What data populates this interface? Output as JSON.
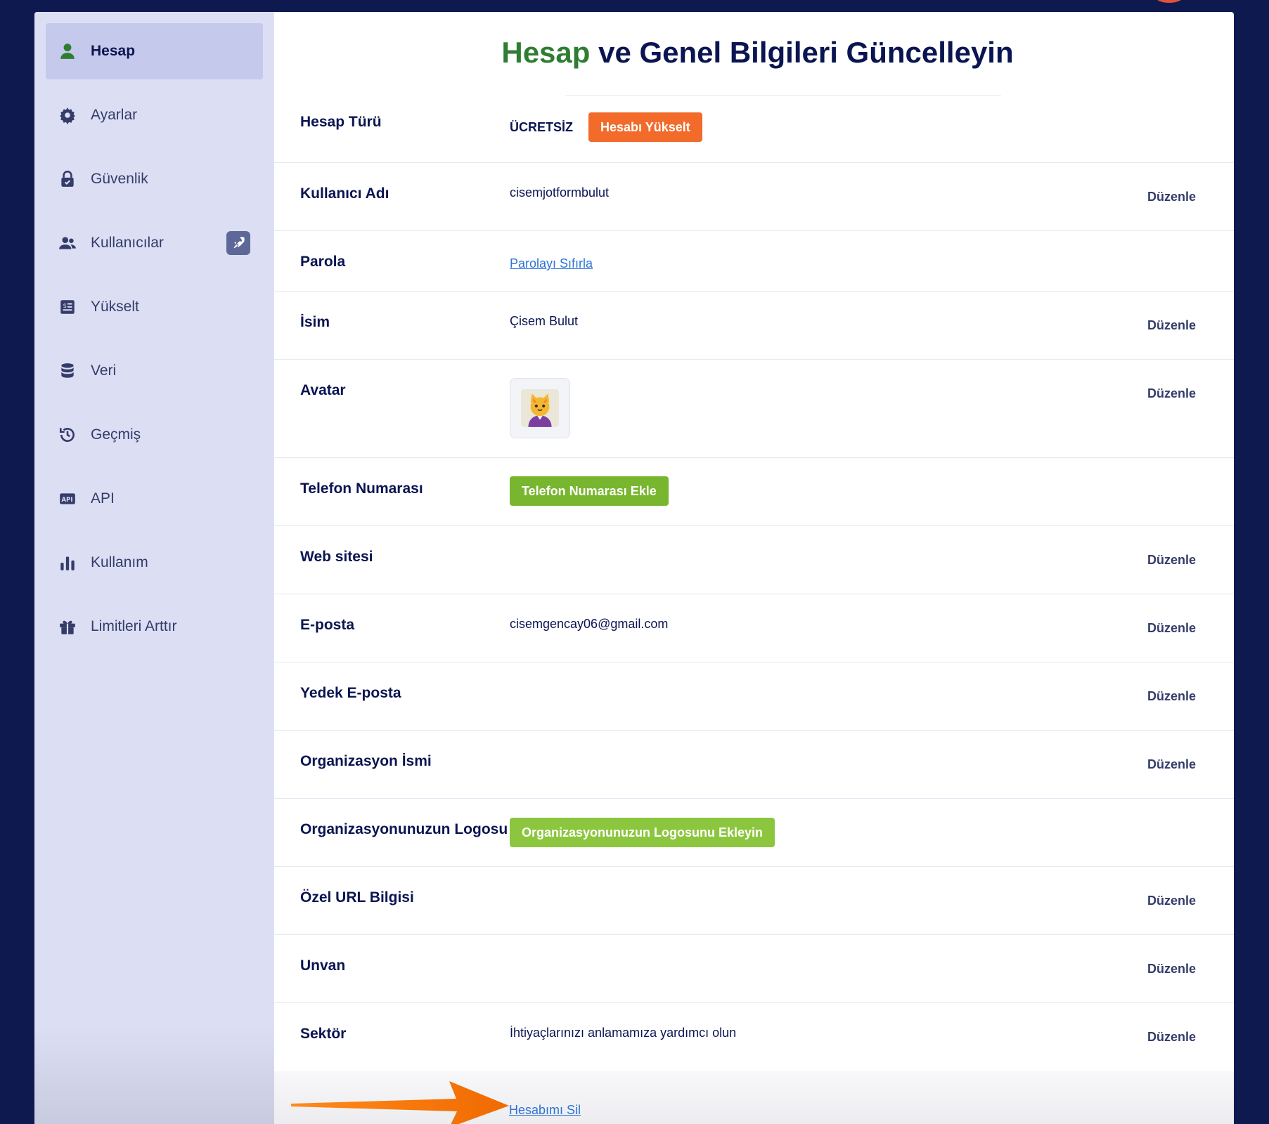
{
  "sidebar": {
    "items": [
      {
        "label": "Hesap",
        "icon": "user-icon",
        "active": true
      },
      {
        "label": "Ayarlar",
        "icon": "gear-icon"
      },
      {
        "label": "Güvenlik",
        "icon": "lock-icon"
      },
      {
        "label": "Kullanıcılar",
        "icon": "users-icon",
        "badge": "rocket-icon"
      },
      {
        "label": "Yükselt",
        "icon": "invoice-icon"
      },
      {
        "label": "Veri",
        "icon": "database-icon"
      },
      {
        "label": "Geçmiş",
        "icon": "history-icon"
      },
      {
        "label": "API",
        "icon": "api-icon"
      },
      {
        "label": "Kullanım",
        "icon": "bar-chart-icon"
      },
      {
        "label": "Limitleri Arttır",
        "icon": "gift-icon"
      }
    ]
  },
  "header": {
    "title_accent": "Hesap",
    "title_rest": " ve Genel Bilgileri Güncelleyin"
  },
  "rows": {
    "account_type": {
      "label": "Hesap Türü",
      "value": "ÜCRETSİZ",
      "button": "Hesabı Yükselt"
    },
    "username": {
      "label": "Kullanıcı Adı",
      "value": "cisemjotformbulut",
      "edit": "Düzenle"
    },
    "password": {
      "label": "Parola",
      "link": "Parolayı Sıfırla"
    },
    "name": {
      "label": "İsim",
      "value": "Çisem Bulut",
      "edit": "Düzenle"
    },
    "avatar": {
      "label": "Avatar",
      "edit": "Düzenle"
    },
    "phone": {
      "label": "Telefon Numarası",
      "button": "Telefon Numarası Ekle"
    },
    "website": {
      "label": "Web sitesi",
      "edit": "Düzenle"
    },
    "email": {
      "label": "E-posta",
      "value": "cisemgencay06@gmail.com",
      "edit": "Düzenle"
    },
    "backup_email": {
      "label": "Yedek E-posta",
      "edit": "Düzenle"
    },
    "org_name": {
      "label": "Organizasyon İsmi",
      "edit": "Düzenle"
    },
    "org_logo": {
      "label": "Organizasyonunuzun Logosu",
      "button": "Organizasyonunuzun Logosunu Ekleyin"
    },
    "custom_url": {
      "label": "Özel URL Bilgisi",
      "edit": "Düzenle"
    },
    "title": {
      "label": "Unvan",
      "edit": "Düzenle"
    },
    "sector": {
      "label": "Sektör",
      "value": "İhtiyaçlarınızı anlamamıza yardımcı olun",
      "edit": "Düzenle"
    }
  },
  "footer": {
    "delete_link": "Hesabımı Sil"
  },
  "colors": {
    "background": "#0e1a4f",
    "sidebar": "#dcdff4",
    "accent_green": "#2f7d32",
    "orange": "#f26b2b",
    "green_button": "#78b62f",
    "link": "#2d74d6",
    "annotation_arrow": "#f57c00"
  }
}
